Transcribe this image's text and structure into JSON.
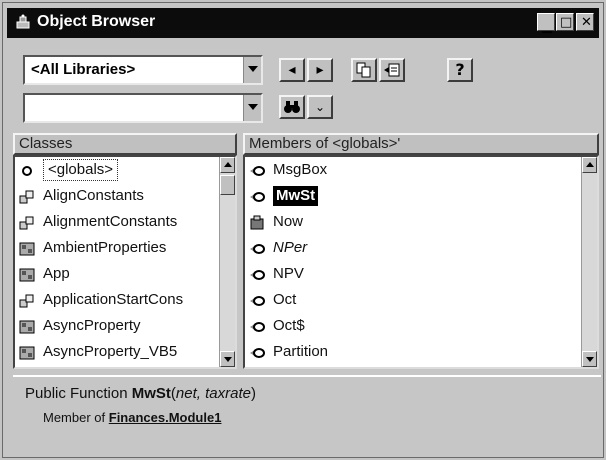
{
  "window": {
    "title": "Object Browser"
  },
  "toolbar": {
    "library_value": "<All Libraries>",
    "search_value": "",
    "help_label": "?"
  },
  "classes": {
    "header": "Classes",
    "items": [
      {
        "label": "<globals>",
        "icon": "globals-icon"
      },
      {
        "label": "AlignConstants",
        "icon": "enum-icon"
      },
      {
        "label": "AlignmentConstants",
        "icon": "enum-icon"
      },
      {
        "label": "AmbientProperties",
        "icon": "class-icon"
      },
      {
        "label": "App",
        "icon": "class-icon"
      },
      {
        "label": "ApplicationStartCons",
        "icon": "enum-icon"
      },
      {
        "label": "AsyncProperty",
        "icon": "class-icon"
      },
      {
        "label": "AsyncProperty_VB5",
        "icon": "class-icon"
      }
    ]
  },
  "members": {
    "header": "Members of <globals>'",
    "items": [
      {
        "label": "MsgBox",
        "icon": "method-icon"
      },
      {
        "label": "MwSt",
        "icon": "method-icon",
        "selected": true
      },
      {
        "label": "Now",
        "icon": "property-icon"
      },
      {
        "label": "NPer",
        "icon": "method-icon",
        "italic": true
      },
      {
        "label": "NPV",
        "icon": "method-icon"
      },
      {
        "label": "Oct",
        "icon": "method-icon"
      },
      {
        "label": "Oct$",
        "icon": "method-icon"
      },
      {
        "label": "Partition",
        "icon": "method-icon"
      }
    ]
  },
  "details": {
    "prefix": "Public Function ",
    "name": "MwSt",
    "open_paren": "(",
    "params": "net, taxrate",
    "close_paren": ")",
    "member_of_label": "Member of ",
    "member_of_link": "Finances.Module1"
  },
  "colors": {
    "title_bar": "#0c0c0c",
    "selection": "#000000",
    "window_bg": "#c6c6c6"
  }
}
